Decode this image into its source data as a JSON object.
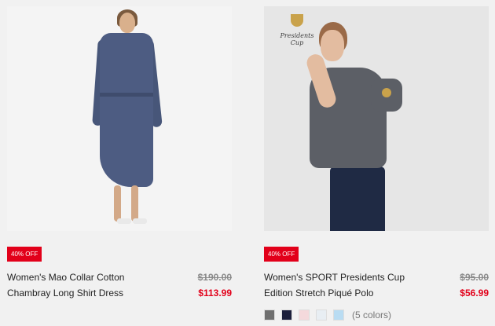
{
  "products": [
    {
      "badge": "40% OFF",
      "name_line1": "Women's Mao Collar Cotton",
      "name_line2": "Chambray Long Shirt Dress",
      "old_price": "$190.00",
      "new_price": "$113.99"
    },
    {
      "badge": "40% OFF",
      "name_line1": "Women's SPORT Presidents Cup",
      "name_line2": "Edition Stretch Piqué Polo",
      "old_price": "$95.00",
      "new_price": "$56.99",
      "logo_text": "Presidents Cup",
      "colors_label": "(5 colors)",
      "swatches": [
        "#707070",
        "#1b1f3b",
        "#f4d9dc",
        "#e8eef3",
        "#b9dcf2"
      ]
    }
  ]
}
